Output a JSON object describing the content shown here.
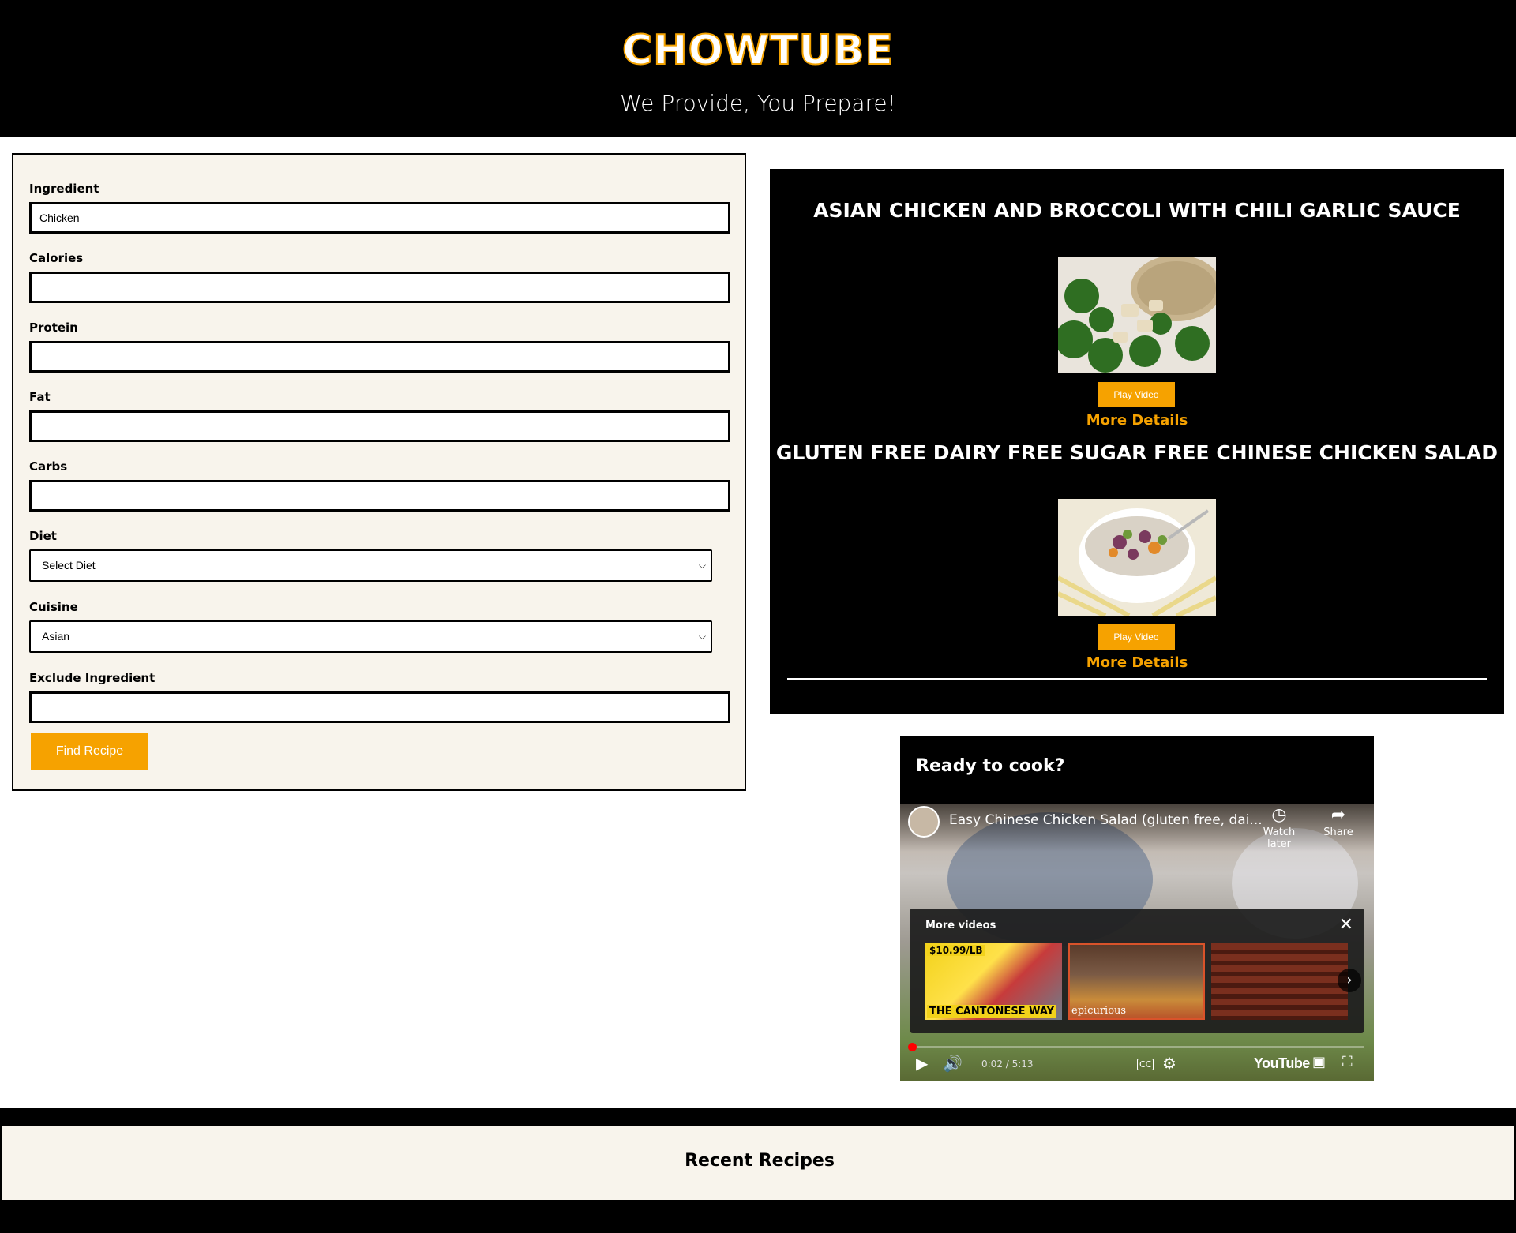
{
  "header": {
    "brand": "CHOWTUBE",
    "tagline": "We Provide, You Prepare!"
  },
  "form": {
    "fields": [
      {
        "label": "Ingredient",
        "value": ""
      },
      {
        "label": "Calories",
        "value": ""
      },
      {
        "label": "Protein",
        "value": ""
      },
      {
        "label": "Fat",
        "value": ""
      },
      {
        "label": "Carbs",
        "value": ""
      }
    ],
    "ingredient_value": "Chicken",
    "diet": {
      "label": "Diet",
      "selected": "Select Diet"
    },
    "cuisine": {
      "label": "Cuisine",
      "selected": "Asian"
    },
    "exclude": {
      "label": "Exclude Ingredient",
      "value": ""
    },
    "submit_label": "Find Recipe"
  },
  "results": {
    "recipes": [
      {
        "title": "ASIAN CHICKEN AND BROCCOLI WITH CHILI GARLIC SAUCE",
        "play_label": "Play Video",
        "details_label": "More Details"
      },
      {
        "title": "GLUTEN FREE DAIRY FREE SUGAR FREE CHINESE CHICKEN SALAD",
        "play_label": "Play Video",
        "details_label": "More Details"
      }
    ]
  },
  "video_card": {
    "title": "Ready to cook?",
    "player": {
      "video_title": "Easy Chinese Chicken Salad (gluten free, dai...",
      "watch_later_label": "Watch later",
      "share_label": "Share",
      "more_videos_label": "More videos",
      "thumbs": [
        {
          "price": "$10.99/LB",
          "caption": "THE CANTONESE WAY"
        },
        {
          "brand": "epicurious"
        },
        {}
      ],
      "time": "0:02 / 5:13",
      "progress": 0.006,
      "logo": "YouTube",
      "cc_label": "CC"
    }
  },
  "footer": {
    "recent_title": "Recent Recipes"
  },
  "colors": {
    "accent": "#f6a200",
    "panel_bg": "#f8f4ec",
    "dark": "#000000"
  }
}
